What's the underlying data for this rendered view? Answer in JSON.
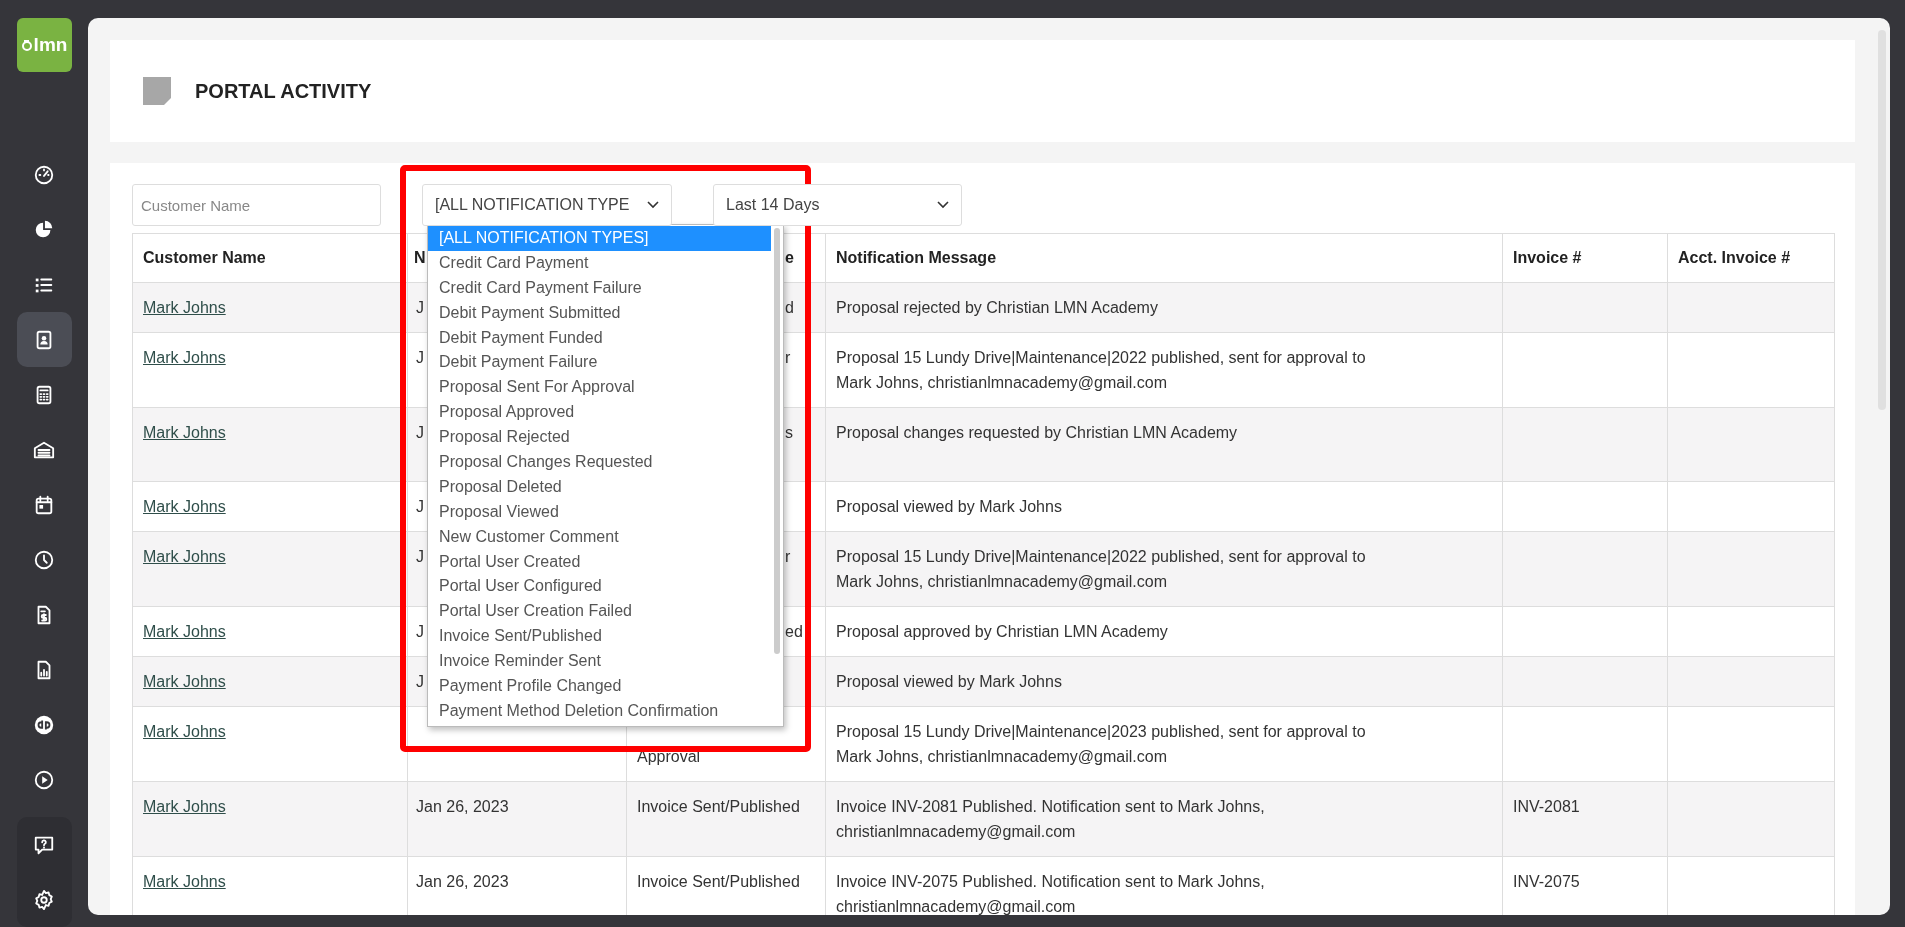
{
  "sidebar": {
    "logo": "lmn",
    "items": [
      {
        "kind": "gauge",
        "selected": false
      },
      {
        "kind": "pie",
        "selected": false
      },
      {
        "kind": "list",
        "selected": false
      },
      {
        "kind": "contact",
        "selected": true
      },
      {
        "kind": "calculator",
        "selected": false
      },
      {
        "kind": "garage",
        "selected": false
      },
      {
        "kind": "calendar",
        "selected": false
      },
      {
        "kind": "clock",
        "selected": false
      },
      {
        "kind": "invoice",
        "selected": false
      },
      {
        "kind": "report",
        "selected": false
      },
      {
        "kind": "qb",
        "selected": false
      },
      {
        "kind": "play",
        "selected": false
      }
    ],
    "footer_items": [
      {
        "kind": "help"
      },
      {
        "kind": "settings"
      }
    ]
  },
  "header": {
    "title": "PORTAL ACTIVITY"
  },
  "filters": {
    "customer": {
      "placeholder": "Customer Name"
    },
    "type_select": {
      "value": "[ALL NOTIFICATION TYPE",
      "expanded": true,
      "options": [
        {
          "label": "[ALL NOTIFICATION TYPES]",
          "selected": true
        },
        {
          "label": "Credit Card Payment",
          "selected": false
        },
        {
          "label": "Credit Card Payment Failure",
          "selected": false
        },
        {
          "label": "Debit Payment Submitted",
          "selected": false
        },
        {
          "label": "Debit Payment Funded",
          "selected": false
        },
        {
          "label": "Debit Payment Failure",
          "selected": false
        },
        {
          "label": "Proposal Sent For Approval",
          "selected": false
        },
        {
          "label": "Proposal Approved",
          "selected": false
        },
        {
          "label": "Proposal Rejected",
          "selected": false
        },
        {
          "label": "Proposal Changes Requested",
          "selected": false
        },
        {
          "label": "Proposal Deleted",
          "selected": false
        },
        {
          "label": "Proposal Viewed",
          "selected": false
        },
        {
          "label": "New Customer Comment",
          "selected": false
        },
        {
          "label": "Portal User Created",
          "selected": false
        },
        {
          "label": "Portal User Configured",
          "selected": false
        },
        {
          "label": "Portal User Creation Failed",
          "selected": false
        },
        {
          "label": "Invoice Sent/Published",
          "selected": false
        },
        {
          "label": "Invoice Reminder Sent",
          "selected": false
        },
        {
          "label": "Payment Profile Changed",
          "selected": false
        },
        {
          "label": "Payment Method Deletion Confirmation",
          "selected": false
        }
      ]
    },
    "period_select": {
      "value": "Last 14 Days"
    }
  },
  "highlight": {
    "kind": "frame"
  },
  "table": {
    "columns": [
      "Customer Name",
      "N",
      "e",
      "Notification Message",
      "Invoice #",
      "Acct. Invoice #"
    ],
    "rows": [
      {
        "customer": "Mark Johns",
        "column_2": "J",
        "column_3": "d",
        "message": "Proposal rejected by Christian LMN Academy"
      },
      {
        "customer": "Mark Johns",
        "column_2": "J",
        "column_3": "r",
        "message": "Proposal 15 Lundy Drive|Maintenance|2022 published, sent for approval to Mark Johns, christianlmnacademy@gmail.com"
      },
      {
        "customer": "Mark Johns",
        "column_2": "J",
        "column_3": "s",
        "message": "Proposal changes requested by Christian LMN Academy",
        "tall": true
      },
      {
        "customer": "Mark Johns",
        "column_2": "J",
        "message": "Proposal viewed by Mark Johns"
      },
      {
        "customer": "Mark Johns",
        "column_2": "J",
        "column_3": "r",
        "message": "Proposal 15 Lundy Drive|Maintenance|2022 published, sent for approval to Mark Johns, christianlmnacademy@gmail.com"
      },
      {
        "customer": "Mark Johns",
        "column_2": "J",
        "column_3": "ed",
        "message": "Proposal approved by Christian LMN Academy"
      },
      {
        "customer": "Mark Johns",
        "column_2": "J",
        "message": "Proposal viewed by Mark Johns"
      },
      {
        "customer": "Mark Johns",
        "type": "Approval",
        "second_line": true,
        "message": "Proposal 15 Lundy Drive|Maintenance|2023 published, sent for approval to Mark Johns, christianlmnacademy@gmail.com"
      },
      {
        "customer": "Mark Johns",
        "date": "Jan 26, 2023",
        "type": "Invoice Sent/Published",
        "message": "Invoice INV-2081 Published. Notification sent to Mark Johns, christianlmnacademy@gmail.com",
        "invoice": "INV-2081"
      },
      {
        "customer": "Mark Johns",
        "date": "Jan 26, 2023",
        "type": "Invoice Sent/Published",
        "message": "Invoice INV-2075 Published. Notification sent to Mark Johns, christianlmnacademy@gmail.com",
        "invoice": "INV-2075"
      }
    ]
  }
}
